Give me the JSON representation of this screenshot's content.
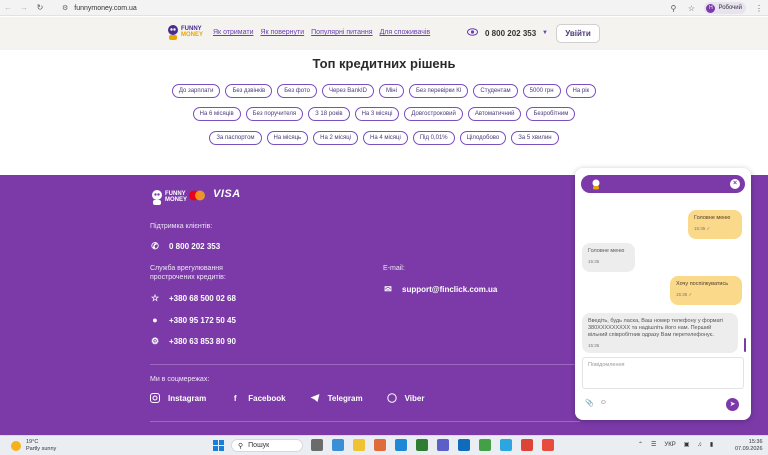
{
  "browser": {
    "url": "funnymoney.com.ua",
    "profile_initial": "Н",
    "profile_name": "Робочий"
  },
  "header": {
    "logo_line1": "FUNNY",
    "logo_line2": "MONEY",
    "nav": [
      "Як отримати",
      "Як повернути",
      "Популярні питання",
      "Для споживачів"
    ],
    "phone": "0 800 202 353",
    "login_label": "Увійти"
  },
  "top_solutions": {
    "title": "Топ кредитних рішень",
    "row1": [
      "До зарплати",
      "Без дзвінків",
      "Без фото",
      "Через BankID",
      "Міні",
      "Без перевірки КІ",
      "Студентам",
      "5000 грн",
      "На рік"
    ],
    "row2": [
      "На 6 місяців",
      "Без поручителя",
      "З 18 років",
      "На 3 місяці",
      "Довгостроковий",
      "Автоматичний",
      "Безробітним"
    ],
    "row3": [
      "За паспортом",
      "На місяць",
      "На 2 місяці",
      "На 4 місяці",
      "Під 0,01%",
      "Цілодобово",
      "За 5 хвилин"
    ]
  },
  "footer": {
    "logo_line1": "FUNNY",
    "logo_line2": "MONEY",
    "visa": "VISA",
    "support_label": "Підтримка клієнтів:",
    "support_phone": "0 800 202 353",
    "overdue_label_line1": "Служба врегулювання",
    "overdue_label_line2": "прострочених кредитів:",
    "overdue_phones": [
      "+380 68 500 02 68",
      "+380 95 172 50 45",
      "+380 63 853 80 90"
    ],
    "email_label": "E-mail:",
    "email": "support@finclick.com.ua",
    "social_label": "Ми в соцмережах:",
    "social": [
      "Instagram",
      "Facebook",
      "Telegram",
      "Viber"
    ]
  },
  "chat": {
    "messages": [
      {
        "side": "out",
        "text": "Головне меню",
        "time": "15:35"
      },
      {
        "side": "in",
        "text": "Головне меню",
        "time": "15:35"
      },
      {
        "side": "out",
        "text": "Хочу поспілкуватись",
        "time": "15:35"
      },
      {
        "side": "in",
        "text": "Введіть, будь ласка, Ваш номер телефону у форматі 380XXXXXXXXX та надішліть його нам. Перший вільний співробітник одразу Вам перетелефонує.",
        "time": "15:35"
      }
    ],
    "input_placeholder": "Повідомлення"
  },
  "taskbar": {
    "temperature": "19°C",
    "weather": "Partly sunny",
    "search_label": "Пошук",
    "language": "УКР",
    "time": "15:36",
    "date": "07.09.2026"
  },
  "colors": {
    "brand_purple": "#7b3aa8",
    "accent_yellow": "#fbd98a"
  }
}
